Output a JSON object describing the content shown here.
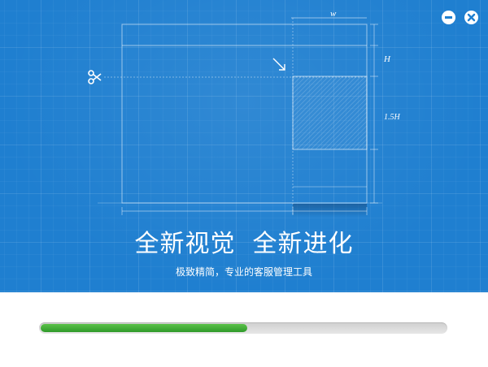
{
  "window": {
    "minimize_icon": "minus-circle-icon",
    "close_icon": "x-circle-icon"
  },
  "blueprint": {
    "width_label": "w",
    "height_label": "H",
    "ratio_label": "1.5H",
    "scissors_icon": "scissors-icon",
    "arrow_icon": "arrow-down-right-icon"
  },
  "hero": {
    "headline": "全新视觉  全新进化",
    "subtitle": "极致精简，专业的客服管理工具"
  },
  "progress": {
    "value": 0.51
  },
  "colors": {
    "hero_background": "#1f7fd0",
    "progress_fill": "#3fa735",
    "progress_track": "#dcdcdc"
  }
}
